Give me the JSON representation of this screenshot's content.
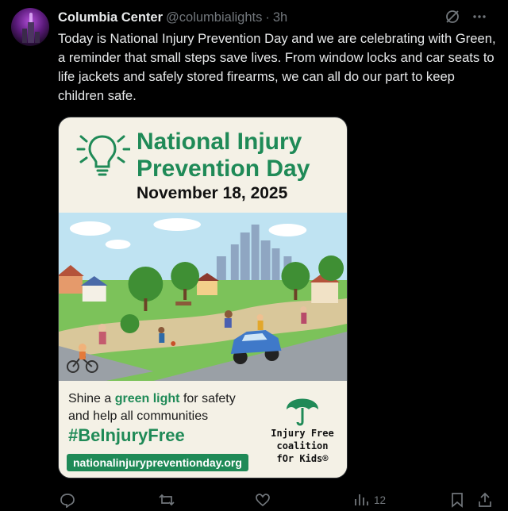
{
  "post": {
    "author_name": "Columbia Center",
    "handle": "@columbialights",
    "separator": "·",
    "time": "3h",
    "body": "Today is National Injury Prevention Day and we are celebrating with Green, a reminder that small steps save lives. From window locks and car seats to life jackets and safely stored firearms, we can all do our part to keep children safe."
  },
  "media": {
    "title_line1": "National Injury",
    "title_line2": "Prevention Day",
    "date": "November 18, 2025",
    "shine_pre": "Shine a ",
    "shine_green": "green light",
    "shine_post": " for safety",
    "shine_line2": "and help all communities",
    "hashtag": "#BeInjuryFree",
    "url": "nationalinjurypreventionday.org",
    "coalition_line1": "Injury Free",
    "coalition_line2": "coalition",
    "coalition_line3": "fOr Kids®"
  },
  "actions": {
    "views_count": "12"
  },
  "icons": {
    "grok": "slashed-circle-icon",
    "more": "more-icon",
    "reply": "reply-icon",
    "repost": "repost-icon",
    "like": "heart-icon",
    "views": "bar-chart-icon",
    "bookmark": "bookmark-icon",
    "share": "share-icon"
  },
  "colors": {
    "brand_green": "#1f8a57",
    "muted": "#71767b",
    "background": "#000000"
  }
}
